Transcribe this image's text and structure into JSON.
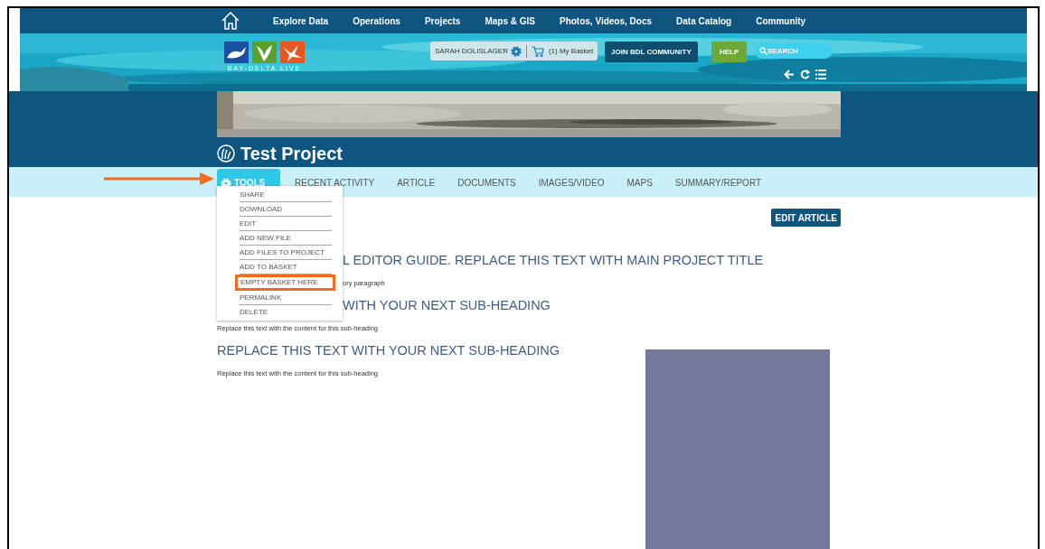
{
  "top_nav": {
    "items": [
      "Explore Data",
      "Operations",
      "Projects",
      "Maps & GIS",
      "Photos, Videos, Docs",
      "Data Catalog",
      "Community"
    ]
  },
  "banner": {
    "logo_text": "BAY-DELTA LIVE",
    "user": "SARAH DOLISLAGER",
    "basket": "(1) My Basket",
    "join_button": "JOIN BDL COMMUNITY",
    "help_button": "HELP",
    "search": {
      "placeholder": "SEARCH"
    }
  },
  "project": {
    "title": "Test Project"
  },
  "tabs": [
    {
      "label": "TOOLS",
      "selected": true
    },
    {
      "label": "RECENT ACTIVITY",
      "selected": false
    },
    {
      "label": "ARTICLE",
      "selected": false
    },
    {
      "label": "DOCUMENTS",
      "selected": false
    },
    {
      "label": "IMAGES/VIDEO",
      "selected": false
    },
    {
      "label": "MAPS",
      "selected": false
    },
    {
      "label": "SUMMARY/REPORT",
      "selected": false
    }
  ],
  "tools_menu": {
    "expanded": true,
    "items": [
      {
        "label": "SHARE",
        "highlighted": false
      },
      {
        "label": "DOWNLOAD",
        "highlighted": false
      },
      {
        "label": "EDIT",
        "highlighted": false
      },
      {
        "label": "ADD NEW FILE",
        "highlighted": false
      },
      {
        "label": "ADD FILES TO PROJECT",
        "highlighted": false
      },
      {
        "label": "ADD TO BASKET",
        "highlighted": false
      },
      {
        "label": "EMPTY BASKET HERE",
        "highlighted": true
      },
      {
        "label": "PERMALINK",
        "highlighted": false
      },
      {
        "label": "DELETE",
        "highlighted": false
      }
    ]
  },
  "edit_button": "EDIT ARTICLE",
  "article": [
    {
      "kind": "title",
      "text": "L EDITOR GUIDE. REPLACE THIS TEXT WITH MAIN PROJECT TITLE",
      "covered": true
    },
    {
      "kind": "paragraph",
      "text": "ory paragraph",
      "covered": true
    },
    {
      "kind": "heading",
      "text": "WITH YOUR NEXT SUB-HEADING",
      "covered": true
    },
    {
      "kind": "paragraph",
      "text": "Replace this text with the content for this sub-heading",
      "covered": false
    },
    {
      "kind": "heading",
      "text": "REPLACE THIS TEXT WITH YOUR NEXT SUB-HEADING",
      "covered": false
    },
    {
      "kind": "paragraph",
      "text": "Replace this text with the content for this sub-heading",
      "covered": false
    }
  ]
}
